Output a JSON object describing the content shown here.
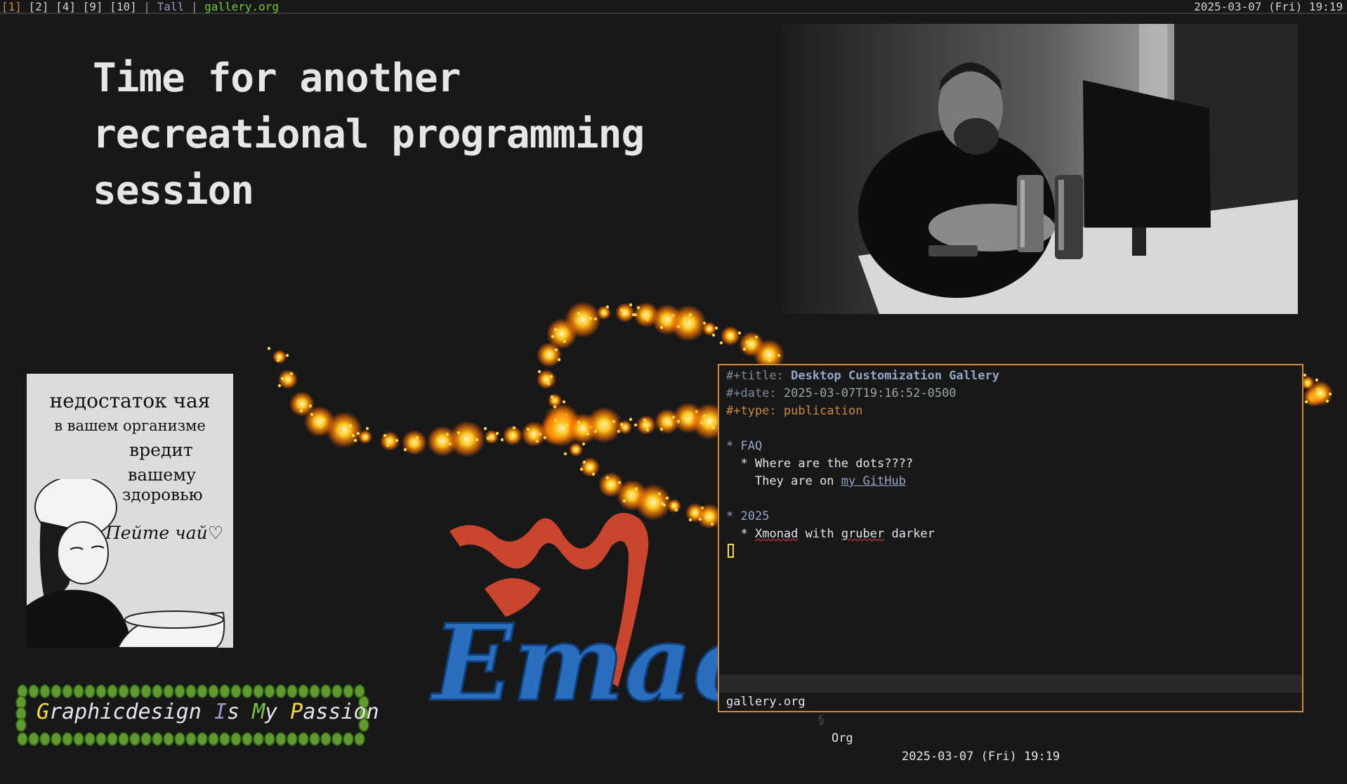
{
  "topbar": {
    "workspaces": [
      "[1]",
      "[2]",
      "[4]",
      "[9]",
      "[10]"
    ],
    "current_workspace": "[1]",
    "separator": "|",
    "layout": "Tall",
    "window_title": "gallery.org",
    "clock": "2025-03-07 (Fri) 19:19"
  },
  "headline": {
    "lines": [
      "Time for another",
      "recreational programming",
      "session"
    ]
  },
  "poster": {
    "line1": "недостаток чая",
    "line2": "в вашем организме",
    "line3": "вредит",
    "line4": "вашему",
    "line5": "здоровью",
    "line6": "Пейте чай♡"
  },
  "badge": {
    "words": [
      {
        "initial": "G",
        "rest": "raphicdesign"
      },
      {
        "initial": "I",
        "rest": "s"
      },
      {
        "initial": "M",
        "rest": "y"
      },
      {
        "initial": "P",
        "rest": "assion"
      }
    ]
  },
  "emacs_logo": {
    "text": "Emacs"
  },
  "editor": {
    "title_key": "#+title:",
    "title_value": "Desktop Customization Gallery",
    "date_key": "#+date:",
    "date_value": "2025-03-07T19:16:52-0500",
    "type_key": "#+type:",
    "type_value": "publication",
    "faq_heading": "FAQ",
    "faq_item": "Where are the dots????",
    "faq_answer_prefix": "They are on ",
    "faq_link": "my GitHub",
    "year_heading": "2025",
    "year_item_word1": "Xmonad",
    "year_item_mid": " with ",
    "year_item_word2": "gruber",
    "year_item_end": " darker",
    "bullet": "*"
  },
  "modeline": {
    "file": "gallery.org",
    "separator": "§",
    "mode": "Org",
    "time": "2025-03-07 (Fri) 19:19"
  },
  "colors": {
    "background": "#181818",
    "accent_border": "#cc8c3c",
    "green": "#73c936",
    "yellow": "#ffdd33",
    "niagara": "#96a6c8",
    "wisteria": "#9e95c7"
  }
}
